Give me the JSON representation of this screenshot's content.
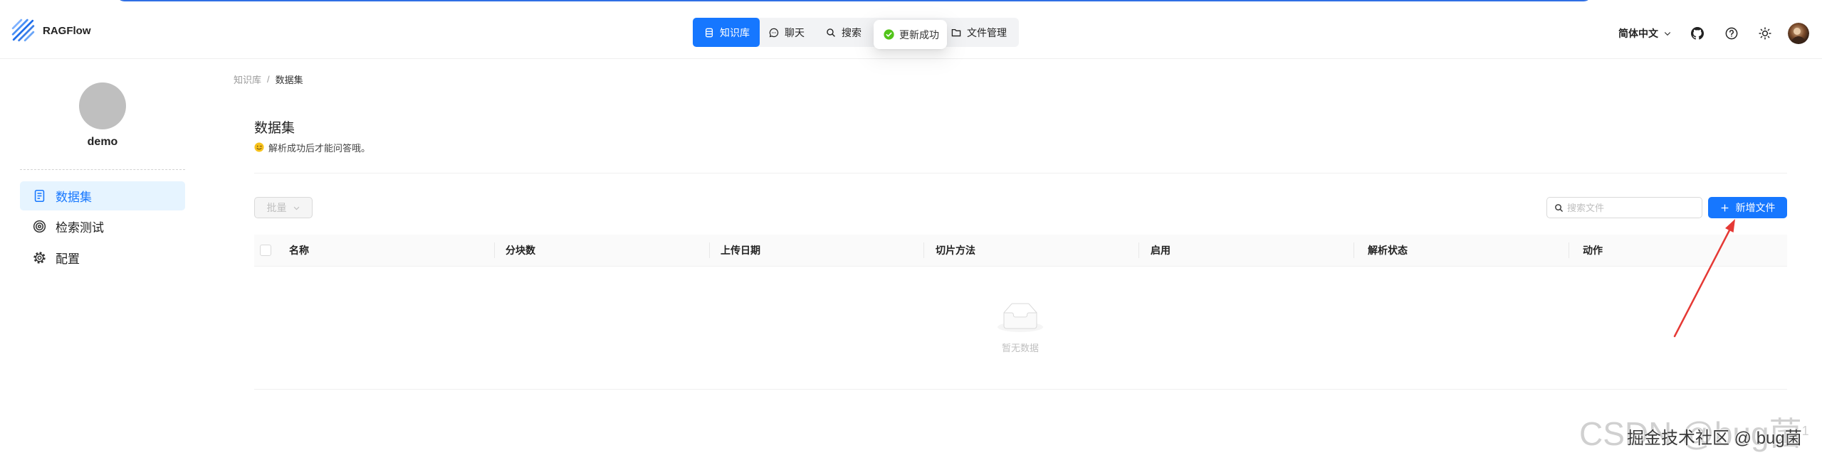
{
  "app": {
    "name": "RAGFlow",
    "logo_icon": "ragflow-logo-icon"
  },
  "nav": {
    "items": [
      {
        "label": "知识库",
        "icon": "database-icon",
        "active": true
      },
      {
        "label": "聊天",
        "icon": "chat-icon",
        "active": false
      },
      {
        "label": "搜索",
        "icon": "search-icon",
        "active": false
      },
      {
        "label": "文件管理",
        "icon": "folder-icon",
        "active": false
      }
    ]
  },
  "toast": {
    "message": "更新成功",
    "icon": "check-circle-icon"
  },
  "header_right": {
    "language": "简体中文",
    "icons": [
      "chevron-down-icon",
      "github-icon",
      "help-icon",
      "sun-icon",
      "user-avatar"
    ]
  },
  "sidebar": {
    "kb_name": "demo",
    "items": [
      {
        "label": "数据集",
        "icon": "document-icon",
        "active": true
      },
      {
        "label": "检索测试",
        "icon": "target-icon",
        "active": false
      },
      {
        "label": "配置",
        "icon": "gear-icon",
        "active": false
      }
    ]
  },
  "breadcrumb": {
    "root": "知识库",
    "separator": "/",
    "current": "数据集"
  },
  "page": {
    "title": "数据集",
    "subtitle_icon": "wink-emoji-icon",
    "subtitle": "解析成功后才能问答哦。"
  },
  "toolbar": {
    "bulk_label": "批量",
    "search_placeholder": "搜索文件",
    "add_label": "新增文件",
    "add_icon": "plus-icon"
  },
  "table": {
    "columns": [
      "名称",
      "分块数",
      "上传日期",
      "切片方法",
      "启用",
      "解析状态",
      "动作"
    ],
    "empty_text": "暂无数据",
    "empty_icon": "empty-inbox-icon"
  },
  "annotation": {
    "type": "red-arrow",
    "target": "add-file-button"
  },
  "watermark": {
    "csdn": "CSDN @bug菌",
    "csdn_sup": "1",
    "juejin": "掘金技术社区 @ bug菌"
  },
  "colors": {
    "primary": "#1677ff",
    "active_bg": "#e6f4ff",
    "success": "#52c41a",
    "annotation_arrow": "#e53935",
    "table_header_bg": "#fafafa"
  }
}
